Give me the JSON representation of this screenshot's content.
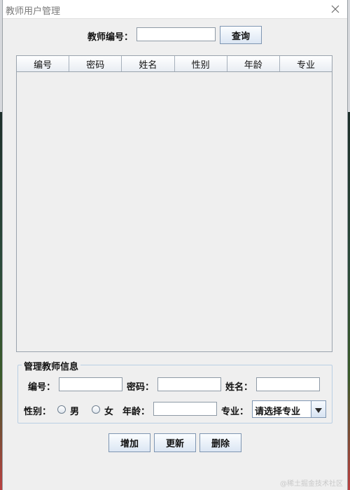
{
  "window": {
    "title": "教师用户管理"
  },
  "query": {
    "label": "教师编号：",
    "input_value": "",
    "button_label": "查询"
  },
  "table": {
    "columns": [
      "编号",
      "密码",
      "姓名",
      "性别",
      "年龄",
      "专业"
    ],
    "rows": []
  },
  "manage_group": {
    "title": "管理教师信息",
    "id_label": "编号：",
    "id_value": "",
    "password_label": "密码：",
    "password_value": "",
    "name_label": "姓名：",
    "name_value": "",
    "gender_label": "性别：",
    "gender_male": "男",
    "gender_female": "女",
    "age_label": "年龄：",
    "age_value": "",
    "major_label": "专业：",
    "major_selected": "请选择专业"
  },
  "actions": {
    "add_label": "增加",
    "update_label": "更新",
    "delete_label": "删除"
  },
  "watermark": {
    "text": "@稀土掘金技术社区"
  },
  "icons": {
    "close": "close-icon",
    "dropdown": "triangle-down-icon"
  },
  "colors": {
    "window_bg": "#efefef",
    "border_accent": "#7f96b2"
  }
}
